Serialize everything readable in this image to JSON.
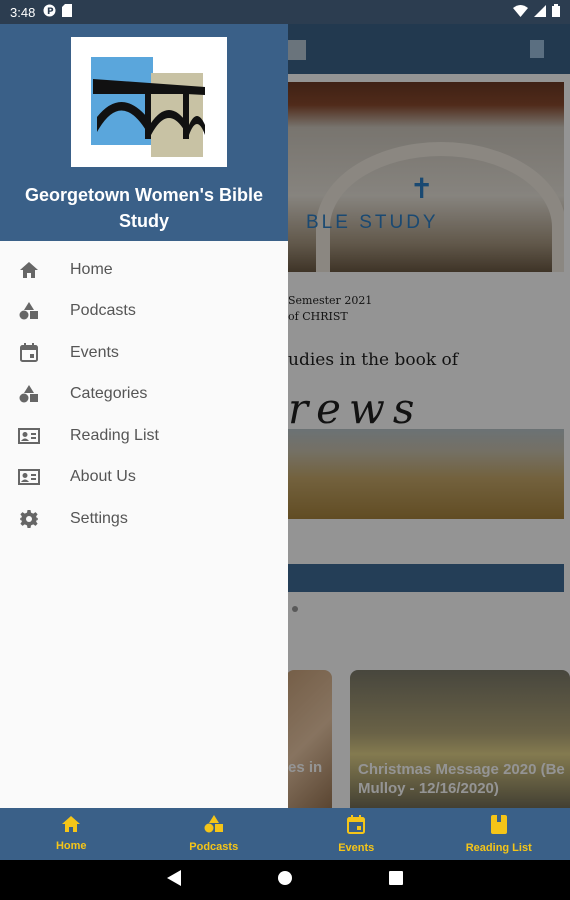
{
  "status_bar": {
    "time": "3:48"
  },
  "drawer": {
    "title": "Georgetown Women's Bible Study",
    "items": [
      {
        "label": "Home",
        "icon": "home-icon"
      },
      {
        "label": "Podcasts",
        "icon": "shapes-icon"
      },
      {
        "label": "Events",
        "icon": "calendar-icon"
      },
      {
        "label": "Categories",
        "icon": "shapes-icon"
      },
      {
        "label": "Reading List",
        "icon": "id-card-icon"
      },
      {
        "label": "About Us",
        "icon": "id-card-icon"
      },
      {
        "label": "Settings",
        "icon": "gear-icon"
      }
    ]
  },
  "background": {
    "hero_text": "BLE  STUDY",
    "semester": "Semester 2021",
    "christ": "of CHRIST",
    "studies": "udies in the book of",
    "hebrews": "rews",
    "thumb1_text": "es in",
    "thumb2_text": "Christmas Message 2020 (Be",
    "thumb2_sub": "Mulloy - 12/16/2020)"
  },
  "bottom_nav": {
    "items": [
      {
        "label": "Home"
      },
      {
        "label": "Podcasts"
      },
      {
        "label": "Events"
      },
      {
        "label": "Reading List"
      }
    ],
    "accent": "#f5c518"
  },
  "colors": {
    "primary": "#3a6088",
    "status": "#2c3d50",
    "accent": "#f5c518"
  }
}
